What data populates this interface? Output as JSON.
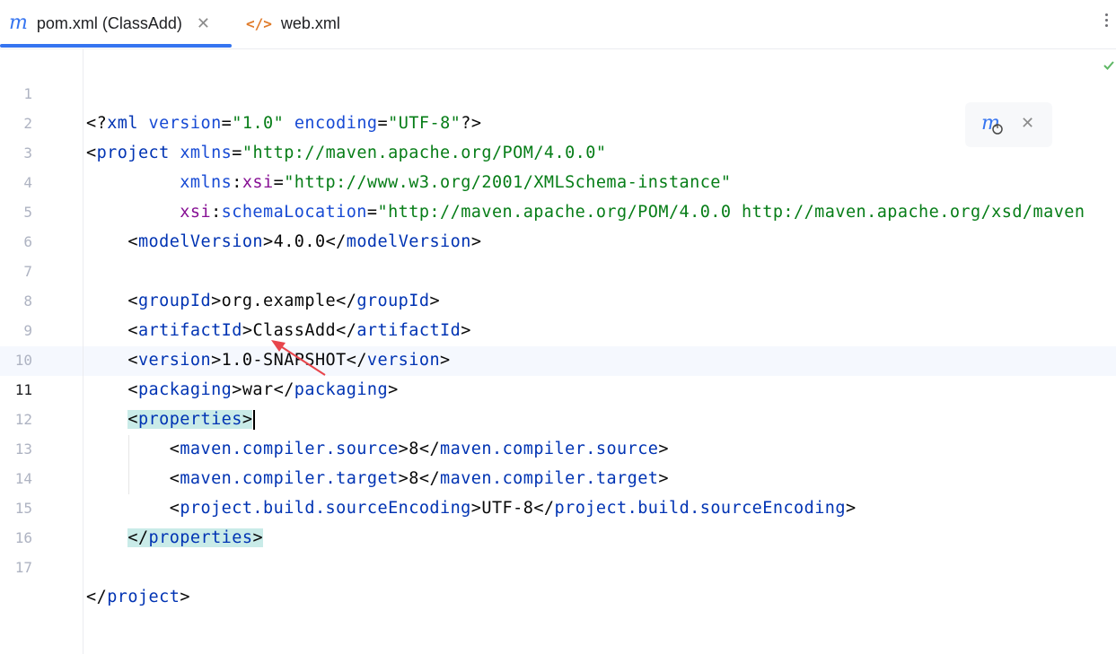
{
  "tabs": [
    {
      "label": "pom.xml (ClassAdd)",
      "icon": "maven-icon",
      "active": true
    },
    {
      "label": "web.xml",
      "icon": "xml-file-icon",
      "active": false
    }
  ],
  "editor": {
    "current_line": 11,
    "line_numbers": [
      "1",
      "2",
      "3",
      "4",
      "5",
      "6",
      "7",
      "8",
      "9",
      "10",
      "11",
      "12",
      "13",
      "14",
      "15",
      "16",
      "17"
    ],
    "xml_decl": {
      "version_attr": "version",
      "version_val": "\"1.0\"",
      "encoding_attr": "encoding",
      "encoding_val": "\"UTF-8\""
    },
    "project_ns": {
      "xmlns_val": "\"http://maven.apache.org/POM/4.0.0\"",
      "xsi_val": "\"http://www.w3.org/2001/XMLSchema-instance\"",
      "schema_val": "\"http://maven.apache.org/POM/4.0.0 http://maven.apache.org/xsd/maven"
    },
    "model_version": "4.0.0",
    "group_id": "org.example",
    "artifact_id": "ClassAdd",
    "version": "1.0-SNAPSHOT",
    "packaging": "war",
    "compiler_source": "8",
    "compiler_target": "8",
    "source_encoding": "UTF-8"
  },
  "colors": {
    "tag": "#0033b3",
    "attribute_value": "#067d17",
    "namespace_prefix": "#871094",
    "tag_highlight": "#c9ebe8",
    "accent": "#3574f0",
    "annotation_arrow": "#e8454b"
  }
}
